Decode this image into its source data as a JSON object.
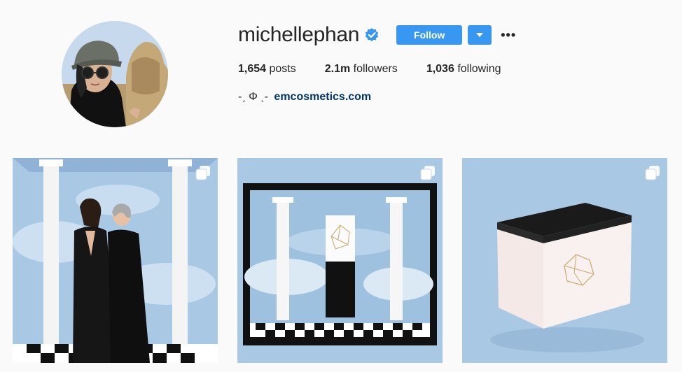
{
  "profile": {
    "username": "michellephan",
    "verified": true,
    "follow_label": "Follow",
    "more_label": "•••",
    "stats": {
      "posts_count": "1,654",
      "posts_label": "posts",
      "followers_count": "2.1m",
      "followers_label": "followers",
      "following_count": "1,036",
      "following_label": "following"
    },
    "bio": {
      "prefix": "-ˏ Φ ˎ-",
      "link": "emcosmetics.com"
    }
  },
  "colors": {
    "accent": "#3897f0",
    "link": "#003569",
    "sky": "#aecbe6",
    "background": "#fafafa"
  },
  "posts": [
    {
      "icon": "multi-photo-icon"
    },
    {
      "icon": "multi-photo-icon"
    },
    {
      "icon": "multi-photo-icon"
    }
  ]
}
